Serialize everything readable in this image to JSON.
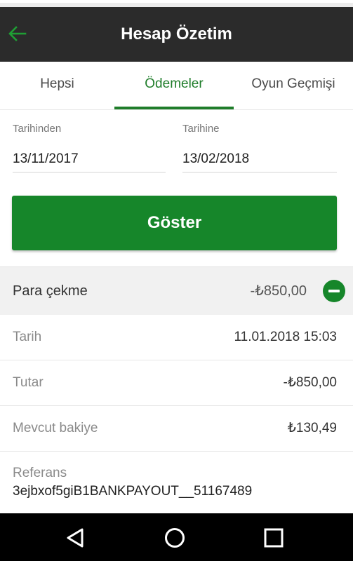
{
  "header": {
    "title": "Hesap Özetim"
  },
  "tabs": [
    {
      "label": "Hepsi"
    },
    {
      "label": "Ödemeler"
    },
    {
      "label": "Oyun Geçmişi"
    }
  ],
  "filters": {
    "from_label": "Tarihinden",
    "from_value": "13/11/2017",
    "to_label": "Tarihine",
    "to_value": "13/02/2018",
    "show_label": "Göster"
  },
  "transaction": {
    "title": "Para çekme",
    "amount": "-₺850,00",
    "details": [
      {
        "label": "Tarih",
        "value": "11.01.2018 15:03"
      },
      {
        "label": "Tutar",
        "value": "-₺850,00"
      },
      {
        "label": "Mevcut bakiye",
        "value": "₺130,49"
      }
    ],
    "reference_label": "Referans",
    "reference_value": "3ejbxof5giB1BANKPAYOUT__51167489"
  },
  "colors": {
    "accent": "#16862a",
    "header_bg": "#2b2b2b"
  },
  "icons": [
    "back-arrow-icon",
    "collapse-icon",
    "nav-back-icon",
    "nav-home-icon",
    "nav-recents-icon"
  ]
}
